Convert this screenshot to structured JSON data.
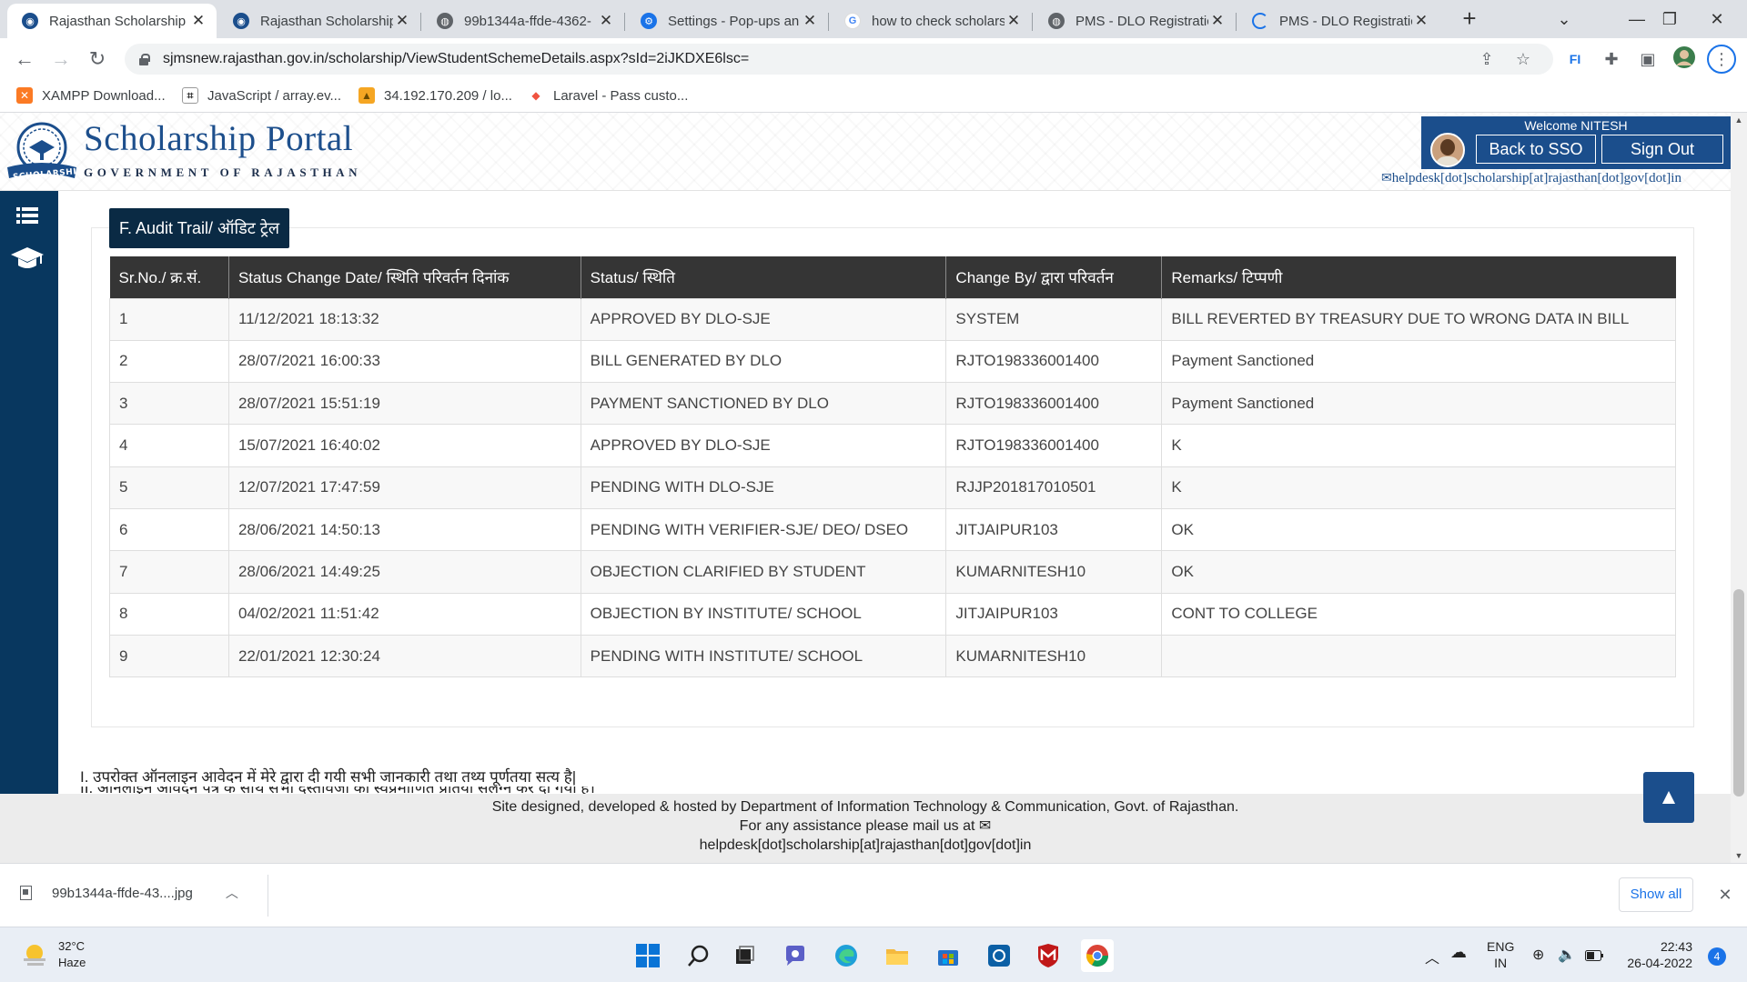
{
  "browser": {
    "tabs": [
      {
        "label": "Rajasthan Scholarship",
        "icon": "scholarship-favicon",
        "active": true
      },
      {
        "label": "Rajasthan Scholarship",
        "icon": "scholarship-favicon",
        "active": false
      },
      {
        "label": "99b1344a-ffde-4362-",
        "icon": "globe-icon",
        "active": false
      },
      {
        "label": "Settings - Pop-ups an",
        "icon": "gear-icon",
        "active": false
      },
      {
        "label": "how to check scholars",
        "icon": "google-icon",
        "active": false
      },
      {
        "label": "PMS - DLO Registratic",
        "icon": "globe-icon",
        "active": false
      },
      {
        "label": "PMS - DLO Registratic",
        "icon": "loading-spinner-icon",
        "active": false
      }
    ],
    "url": "sjmsnew.rajasthan.gov.in/scholarship/ViewStudentSchemeDetails.aspx?sId=2iJKDXE6lsc=",
    "bookmarks": [
      {
        "label": "XAMPP Download...",
        "icon": "xampp-icon"
      },
      {
        "label": "JavaScript / array.ev...",
        "icon": "js-icon"
      },
      {
        "label": "34.192.170.209 / lo...",
        "icon": "phpmyadmin-icon"
      },
      {
        "label": "Laravel - Pass custo...",
        "icon": "laravel-icon"
      }
    ]
  },
  "header": {
    "title": "Scholarship Portal",
    "subtitle": "GOVERNMENT OF RAJASTHAN",
    "emblem_text": "SCHOLARSHIP",
    "welcome": "Welcome NITESH",
    "back_to_sso": "Back to SSO",
    "sign_out": "Sign Out",
    "helpdesk": "helpdesk[dot]scholarship[at]rajasthan[dot]gov[dot]in"
  },
  "audit": {
    "section_title": "F. Audit Trail/ ऑडिट ट्रेल",
    "columns": [
      "Sr.No./ क्र.सं.",
      "Status Change Date/ स्थिति परिवर्तन दिनांक",
      "Status/ स्थिति",
      "Change By/ द्वारा परिवर्तन",
      "Remarks/ टिप्पणी"
    ],
    "rows": [
      [
        "1",
        "11/12/2021 18:13:32",
        "APPROVED BY DLO-SJE",
        "SYSTEM",
        "BILL REVERTED BY TREASURY DUE TO WRONG DATA IN BILL"
      ],
      [
        "2",
        "28/07/2021 16:00:33",
        "BILL GENERATED BY DLO",
        "RJTO198336001400",
        "Payment Sanctioned"
      ],
      [
        "3",
        "28/07/2021 15:51:19",
        "PAYMENT SANCTIONED BY DLO",
        "RJTO198336001400",
        "Payment Sanctioned"
      ],
      [
        "4",
        "15/07/2021 16:40:02",
        "APPROVED BY DLO-SJE",
        "RJTO198336001400",
        "K"
      ],
      [
        "5",
        "12/07/2021 17:47:59",
        "PENDING WITH DLO-SJE",
        "RJJP201817010501",
        "K"
      ],
      [
        "6",
        "28/06/2021 14:50:13",
        "PENDING WITH VERIFIER-SJE/ DEO/ DSEO",
        "JITJAIPUR103",
        "OK"
      ],
      [
        "7",
        "28/06/2021 14:49:25",
        "OBJECTION CLARIFIED BY STUDENT",
        "KUMARNITESH10",
        "OK"
      ],
      [
        "8",
        "04/02/2021 11:51:42",
        "OBJECTION BY INSTITUTE/ SCHOOL",
        "JITJAIPUR103",
        "CONT TO COLLEGE"
      ],
      [
        "9",
        "22/01/2021 12:30:24",
        "PENDING WITH INSTITUTE/ SCHOOL",
        "KUMARNITESH10",
        ""
      ]
    ]
  },
  "declaration": {
    "line1": "I. उपरोक्त ऑनलाइन आवेदन में मेरे द्वारा दी गयी सभी जानकारी तथा तथ्य पूर्णतया सत्य है|",
    "line2": "II. ऑनलाइन आवेदन पत्र के साथ सभी दस्तावेजों की स्वप्रमाणित प्रतियां संलग्न कर दी गयी हैं।"
  },
  "footer": {
    "line1": "Site designed, developed & hosted by Department of Information Technology & Communication, Govt. of Rajasthan.",
    "line2": "For any assistance please mail us at",
    "line3": "helpdesk[dot]scholarship[at]rajasthan[dot]gov[dot]in"
  },
  "downloads": {
    "file": "99b1344a-ffde-43....jpg",
    "show_all": "Show all"
  },
  "taskbar": {
    "temperature": "32°C",
    "weather": "Haze",
    "lang_top": "ENG",
    "lang_bottom": "IN",
    "time": "22:43",
    "date": "26-04-2022",
    "notifications": "4"
  },
  "colors": {
    "brand_blue": "#1b4e8c",
    "sidebar_navy": "#08375f",
    "table_header": "#353535",
    "audit_button": "#0a2a44"
  }
}
